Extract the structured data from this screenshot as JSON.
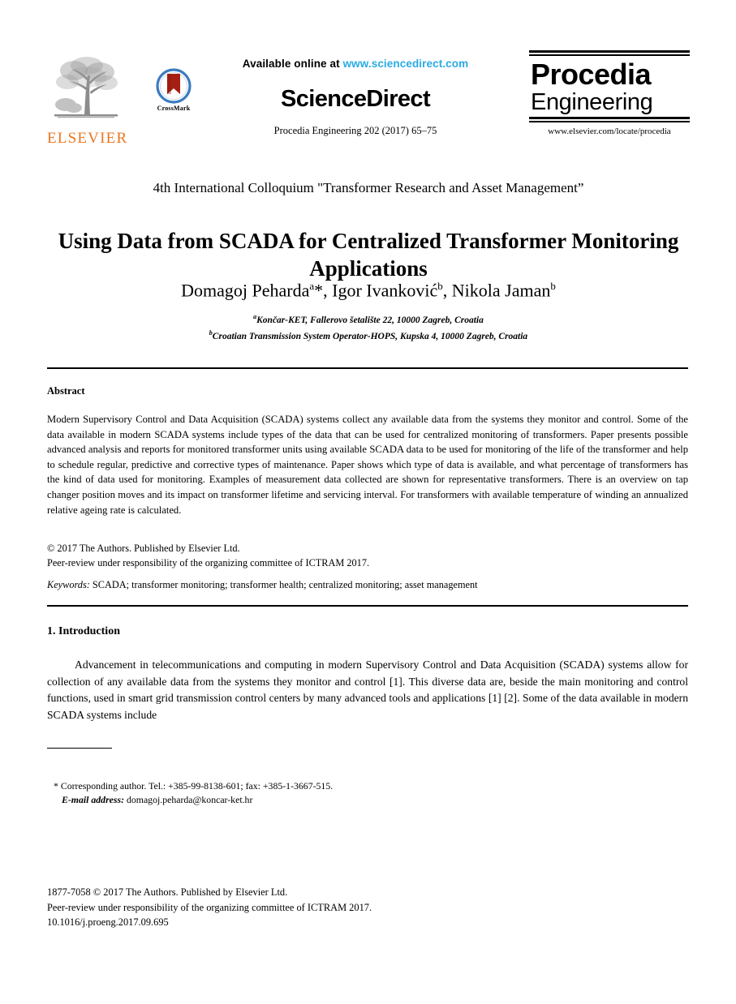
{
  "masthead": {
    "elsevier_wordmark": "ELSEVIER",
    "crossmark_label": "CrossMark",
    "available_prefix": "Available online at ",
    "available_link": "www.sciencedirect.com",
    "sciencedirect_wordmark": "ScienceDirect",
    "series_line": "Procedia Engineering 202 (2017) 65–75",
    "journal_word1": "Procedia",
    "journal_word2": "Engineering",
    "journal_url": "www.elsevier.com/locate/procedia"
  },
  "colors": {
    "elsevier_orange": "#E87722",
    "sciencedirect_link": "#29ABE2",
    "crossmark_blue": "#3B7BBF",
    "crossmark_red": "#A51F12"
  },
  "front": {
    "conference": "4th International Colloquium \"Transformer Research and Asset Management”",
    "title": "Using Data from SCADA for Centralized Transformer Monitoring Applications",
    "authors_html": "Domagoj Peharda<sup>a</sup>*, Igor Ivanković<sup>b</sup>, Nikola Jaman<sup>b</sup>",
    "affiliation_a": "Končar-KET, Fallerovo šetalište 22, 10000 Zagreb, Croatia",
    "affiliation_b": "Croatian Transmission System Operator-HOPS, Kupska 4, 10000 Zagreb, Croatia",
    "affiliation_a_marker": "a",
    "affiliation_b_marker": "b"
  },
  "abstract": {
    "heading": "Abstract",
    "text": "Modern Supervisory Control and Data Acquisition (SCADA) systems collect any available data from the systems they monitor and control. Some of the data available in modern SCADA systems include types of the data that can be used for centralized monitoring of transformers. Paper presents possible advanced analysis and reports for monitored transformer units using available SCADA data to be used for monitoring of the life of the transformer and help to schedule regular, predictive and corrective types of maintenance. Paper shows which type of data is available, and what percentage of transformers has the kind of data used for monitoring. Examples of measurement data collected are shown for representative transformers. There is an overview on tap changer position moves and its impact on transformer lifetime and servicing interval. For transformers with available temperature of winding an annualized relative ageing rate is calculated.",
    "copyright_line1": "© 2017 The Authors. Published by Elsevier Ltd.",
    "copyright_line2": "Peer-review under responsibility of the organizing committee of ICTRAM 2017.",
    "keywords_label": "Keywords:",
    "keywords_value": " SCADA; transformer monitoring; transformer health; centralized monitoring; asset management"
  },
  "introduction": {
    "heading": "1. Introduction",
    "paragraph": "Advancement in telecommunications and computing in modern Supervisory Control and Data Acquisition (SCADA) systems allow for collection of any available data from the systems they monitor and control [1]. This diverse data are, beside the main monitoring and control functions, used in smart grid transmission control centers by many advanced tools and applications [1] [2]. Some of the data available in modern SCADA systems include"
  },
  "footnote": {
    "corresponding": "* Corresponding author. Tel.: +385-99-8138-601; fax: +385-1-3667-515.",
    "email_label": "E-mail address:",
    "email_value": " domagoj.peharda@koncar-ket.hr"
  },
  "page_footer": {
    "issn_line": "1877-7058 © 2017 The Authors. Published by Elsevier Ltd.",
    "peer_review_line": "Peer-review under responsibility of the organizing committee of ICTRAM 2017.",
    "doi_line": "10.1016/j.proeng.2017.09.695"
  }
}
